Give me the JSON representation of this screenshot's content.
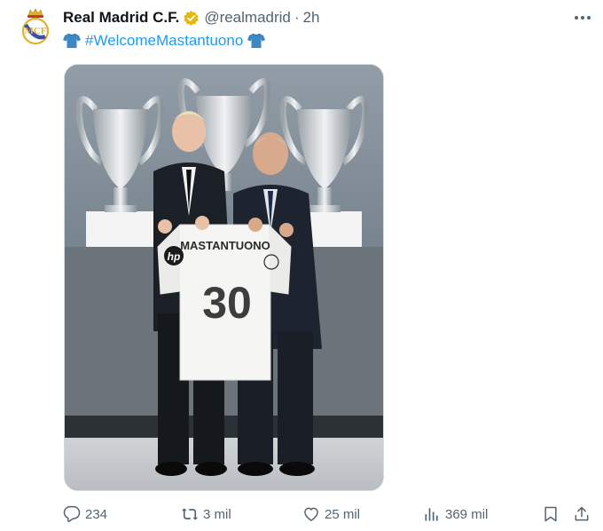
{
  "account": {
    "display_name": "Real Madrid C.F.",
    "handle": "@realmadrid",
    "separator": "·",
    "timestamp": "2h",
    "verified": true,
    "verified_color": "#e2b719"
  },
  "post": {
    "hashtag": "#WelcomeMastantuono",
    "leading_emoji": "blue-tshirt-emoji",
    "trailing_emoji": "blue-tshirt-emoji"
  },
  "media": {
    "jersey_name": "MASTANTUONO",
    "jersey_number": "30",
    "sponsor": "hp"
  },
  "actions": {
    "replies": "234",
    "reposts": "3 mil",
    "likes": "25 mil",
    "views": "369 mil"
  },
  "colors": {
    "link": "#1d9bf0",
    "muted": "#536471",
    "text": "#0f1419"
  }
}
